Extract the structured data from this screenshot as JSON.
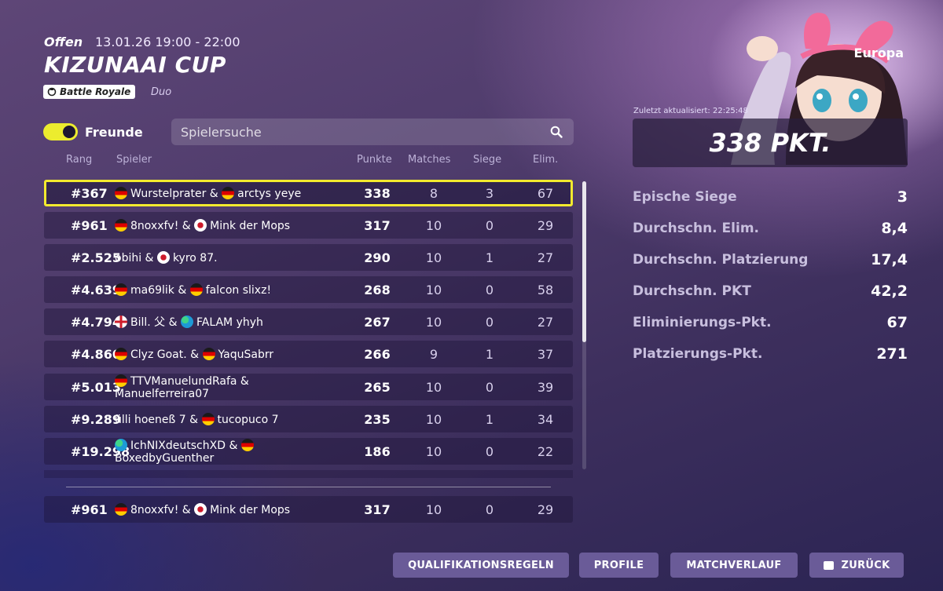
{
  "event": {
    "status": "Offen",
    "datetime": "13.01.26 19:00 - 22:00",
    "title": "KIZUNAAI CUP",
    "mode": "Battle Royale",
    "team_size": "Duo"
  },
  "filter": {
    "friends_label": "Freunde",
    "friends_on": true,
    "search_placeholder": "Spielersuche"
  },
  "columns": {
    "rank": "Rang",
    "player": "Spieler",
    "points": "Punkte",
    "matches": "Matches",
    "wins": "Siege",
    "elims": "Elim."
  },
  "leaderboard": [
    {
      "rank": "#367",
      "p1_flag": "de",
      "p1": "Wurstelprater",
      "p2_flag": "de",
      "p2": "arctys yeye",
      "points": "338",
      "matches": "8",
      "wins": "3",
      "elims": "67",
      "highlight": true
    },
    {
      "rank": "#961",
      "p1_flag": "de",
      "p1": "8noxxfv!",
      "p2_flag": "jp",
      "p2": "Mink der Mops",
      "points": "317",
      "matches": "10",
      "wins": "0",
      "elims": "29"
    },
    {
      "rank": "#2.525",
      "p1_flag": "",
      "p1": "obihi",
      "p2_flag": "jp",
      "p2": "kyro 87.",
      "points": "290",
      "matches": "10",
      "wins": "1",
      "elims": "27"
    },
    {
      "rank": "#4.639",
      "p1_flag": "de",
      "p1": "ma69lik",
      "p2_flag": "de",
      "p2": "falcon slixz!",
      "points": "268",
      "matches": "10",
      "wins": "0",
      "elims": "58"
    },
    {
      "rank": "#4.794",
      "p1_flag": "en",
      "p1": "Bill. 父",
      "p2_flag": "globe",
      "p2": "FALAM yhyh",
      "points": "267",
      "matches": "10",
      "wins": "0",
      "elims": "27"
    },
    {
      "rank": "#4.860",
      "p1_flag": "de",
      "p1": "Clyz Goat.",
      "p2_flag": "de",
      "p2": "YaquSabrr",
      "points": "266",
      "matches": "9",
      "wins": "1",
      "elims": "37"
    },
    {
      "rank": "#5.013",
      "p1_flag": "de",
      "p1": "TTVManuelundRafa",
      "p2_flag": "",
      "p2": "Manuelferreira07",
      "points": "265",
      "matches": "10",
      "wins": "0",
      "elims": "39",
      "wrap": true
    },
    {
      "rank": "#9.289",
      "p1_flag": "",
      "p1": "ülli hoeneß 7",
      "p2_flag": "de",
      "p2": "tucopuco 7",
      "points": "235",
      "matches": "10",
      "wins": "1",
      "elims": "34"
    },
    {
      "rank": "#19.298",
      "p1_flag": "globe",
      "p1": "IchNIXdeutschXD",
      "p2_flag": "de",
      "p2": "BoxedbyGuenther",
      "points": "186",
      "matches": "10",
      "wins": "0",
      "elims": "22",
      "wrap": true,
      "p2_flag_first": true
    }
  ],
  "own_row": {
    "rank": "#961",
    "p1_flag": "de",
    "p1": "8noxxfv!",
    "p2_flag": "jp",
    "p2": "Mink der Mops",
    "points": "317",
    "matches": "10",
    "wins": "0",
    "elims": "29"
  },
  "panel": {
    "region": "Europa",
    "updated": "Zuletzt aktualisiert: 22:25:48",
    "points_total": "338 PKT.",
    "stats": [
      {
        "label": "Epische Siege",
        "value": "3"
      },
      {
        "label": "Durchschn. Elim.",
        "value": "8,4"
      },
      {
        "label": "Durchschn. Platzierung",
        "value": "17,4"
      },
      {
        "label": "Durchschn. PKT",
        "value": "42,2"
      },
      {
        "label": "Eliminierungs-Pkt.",
        "value": "67"
      },
      {
        "label": "Platzierungs-Pkt.",
        "value": "271"
      }
    ]
  },
  "buttons": {
    "rules": "QUALIFIKATIONSREGELN",
    "profiles": "PROFILE",
    "history": "MATCHVERLAUF",
    "back": "ZURÜCK"
  }
}
